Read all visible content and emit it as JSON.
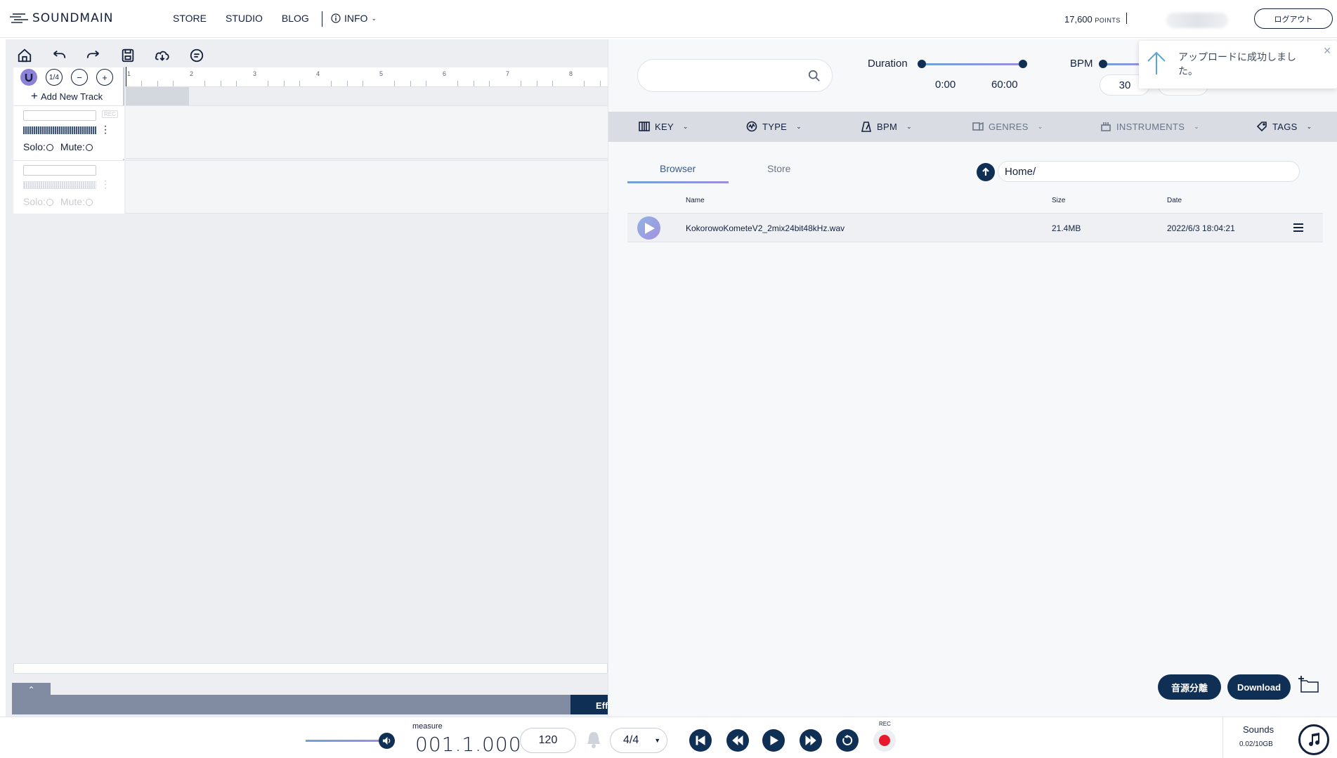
{
  "header": {
    "logo_text": "SOUNDMAIN",
    "nav": [
      "STORE",
      "STUDIO",
      "BLOG"
    ],
    "info_label": "INFO",
    "points_value": "17,600",
    "points_unit": "POINTS",
    "logout_label": "ログアウト"
  },
  "studio": {
    "toolbar_icons": [
      "home-icon",
      "undo-icon",
      "redo-icon",
      "save-icon",
      "cloud-download-icon",
      "comment-icon"
    ],
    "snap_label": "1/4",
    "add_track_label": "Add New Track",
    "rec_label": "REC",
    "solo_label": "Solo:",
    "mute_label": "Mute:",
    "ruler_ticks": [
      "1",
      "2",
      "3",
      "4",
      "5",
      "6",
      "7",
      "8"
    ],
    "effect_tab_label": "Effect"
  },
  "browser": {
    "search_placeholder": "",
    "duration_label": "Duration",
    "duration_min": "0:00",
    "duration_max": "60:00",
    "bpm_label": "BPM",
    "bpm_min": "30",
    "filters": [
      {
        "label": "KEY",
        "icon": "piano-icon"
      },
      {
        "label": "TYPE",
        "icon": "type-icon"
      },
      {
        "label": "BPM",
        "icon": "metronome-icon"
      },
      {
        "label": "GENRES",
        "icon": "genres-icon"
      },
      {
        "label": "INSTRUMENTS",
        "icon": "instruments-icon"
      },
      {
        "label": "TAGS",
        "icon": "tag-icon"
      }
    ],
    "tabs": {
      "browser": "Browser",
      "store": "Store"
    },
    "path": "Home/",
    "columns": {
      "name": "Name",
      "size": "Size",
      "date": "Date"
    },
    "files": [
      {
        "name": "KokorowoKometeV2_2mix24bit48kHz.wav",
        "size": "21.4MB",
        "date": "2022/6/3 18:04:21"
      }
    ],
    "separate_label": "音源分離",
    "download_label": "Download"
  },
  "toast": {
    "message": "アップロードに成功しました。"
  },
  "transport": {
    "measure_label": "measure",
    "measure_value": "001.1.000",
    "tempo": "120",
    "time_signature": "4/4",
    "rec_label": "REC",
    "volume_level": 0.9,
    "sounds_label": "Sounds",
    "sounds_usage": "0.02/10GB"
  },
  "colors": {
    "navy": "#0f2f55",
    "accent_gradient_start": "#6fa2d8",
    "accent_gradient_end": "#9b8de0",
    "record_red": "#e8192c"
  }
}
